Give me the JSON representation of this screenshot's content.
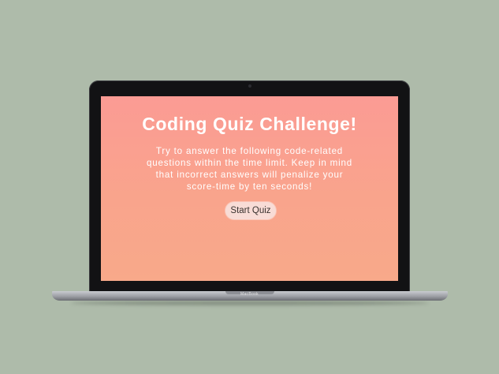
{
  "device": {
    "brand_label": "MacBook"
  },
  "quiz": {
    "title": "Coding Quiz Challenge!",
    "description_lines": [
      "Try to answer the following code-related",
      "questions within the time limit. Keep in mind",
      "that incorrect answers will penalize your",
      "score-time by ten seconds!"
    ],
    "start_button_label": "Start Quiz"
  },
  "colors": {
    "background": "#aebbaa",
    "screen_gradient_top": "#fb9b94",
    "screen_gradient_bottom": "#f8a98a",
    "button_bg": "#f8dcd6",
    "title_text": "#ffffff"
  }
}
